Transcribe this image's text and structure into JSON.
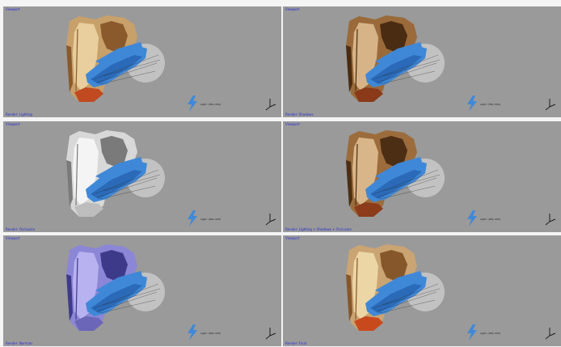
{
  "viewports": [
    {
      "title": "Viewport",
      "status": "Render: Lighting",
      "light_label": "Light: (360, 000)",
      "material": "textured",
      "colors": {
        "base": "#c8a06a",
        "dark": "#8a5a2c",
        "light": "#e8cf9d",
        "accent": "#c14a20"
      }
    },
    {
      "title": "Viewport",
      "status": "Render: Shadows",
      "light_label": "Light: (360, 000)",
      "material": "textured-dark",
      "colors": {
        "base": "#9a6a3a",
        "dark": "#4a2c12",
        "light": "#d6b487",
        "accent": "#8a3a18"
      }
    },
    {
      "title": "Viewport",
      "status": "Render: Occlusion",
      "light_label": "Light: (360, 000)",
      "material": "white",
      "colors": {
        "base": "#d8d8d8",
        "dark": "#7a7a7a",
        "light": "#f4f4f4",
        "accent": "#bdbdbd"
      }
    },
    {
      "title": "Viewport",
      "status": "Render: Lighting + Shadows + Occlusion",
      "light_label": "Light: (360, 000)",
      "material": "textured-dark",
      "colors": {
        "base": "#9c6c3c",
        "dark": "#4c2e14",
        "light": "#d8b68a",
        "accent": "#8c3c1a"
      }
    },
    {
      "title": "Viewport",
      "status": "Render: Normals",
      "light_label": "Light: (360, 000)",
      "material": "normals",
      "colors": {
        "base": "#8c86d6",
        "dark": "#3e3a8a",
        "light": "#b8b2f0",
        "accent": "#6c66b8"
      }
    },
    {
      "title": "Viewport",
      "status": "Render: Final",
      "light_label": "Light: (360, 000)",
      "material": "textured",
      "colors": {
        "base": "#caa472",
        "dark": "#86572a",
        "light": "#ecd6a6",
        "accent": "#c84a1c"
      }
    }
  ],
  "colors": {
    "viewport_bg": "#9a9a9a",
    "divider": "#f4f4f4",
    "blue_cloud": "#3f88d8",
    "blue_cloud_dark": "#2a6ab8",
    "label_text": "#2a2ad8",
    "sphere": "#c9c9c9"
  },
  "icons": {
    "light": "lightning-light-icon",
    "axes": "axis-gizmo-icon"
  }
}
